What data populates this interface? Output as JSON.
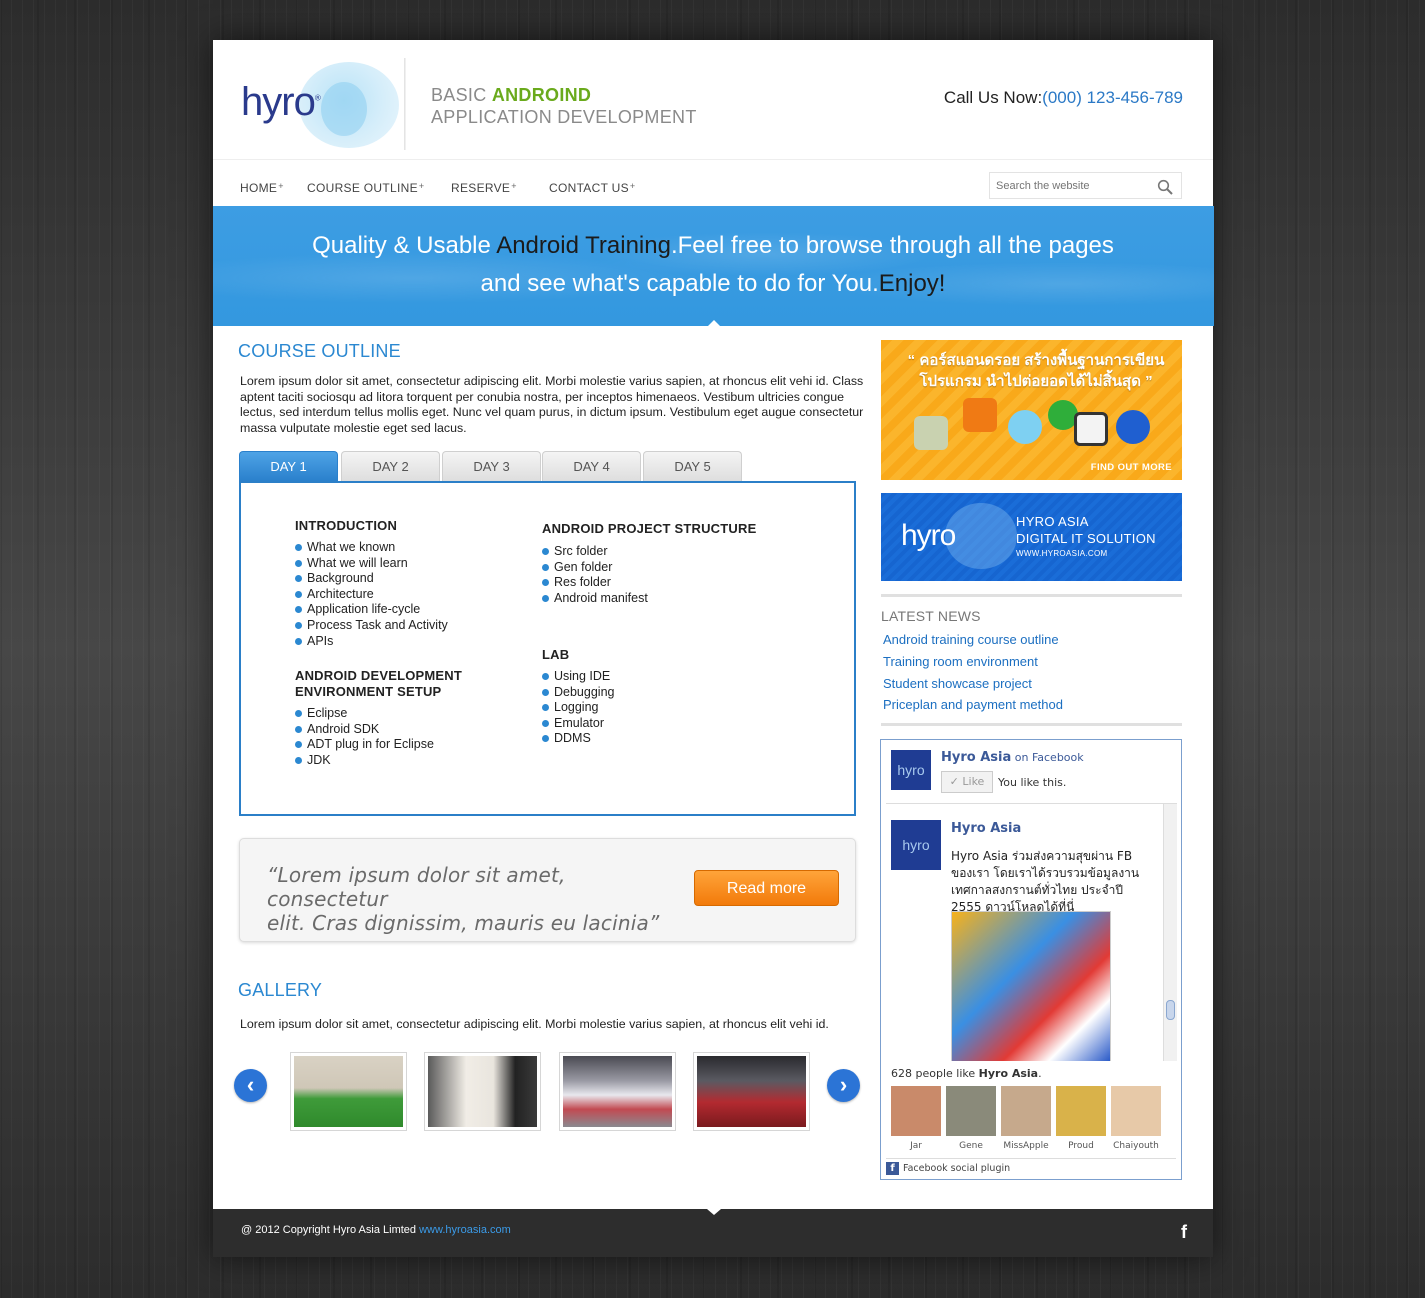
{
  "header": {
    "logo_text": "hyro",
    "title_prefix": "BASIC ",
    "title_accent": "ANDROIND",
    "title_line2": "APPLICATION DEVELOPMENT",
    "call_label": "Call Us Now:",
    "call_phone": "(000) 123-456-789"
  },
  "nav": {
    "items": [
      {
        "label": "HOME"
      },
      {
        "label": "COURSE OUTLINE"
      },
      {
        "label": "RESERVE"
      },
      {
        "label": "CONTACT US"
      }
    ],
    "plus": "+",
    "search_placeholder": "Search the website"
  },
  "hero": {
    "l1_a": "Quality & Usable ",
    "l1_b": "Android Training",
    "l1_c": ".Feel free to browse through all the pages",
    "l2_a": "and see what's capable to do for You.",
    "l2_b": "Enjoy",
    "l2_c": "!"
  },
  "course": {
    "heading": "COURSE OUTLINE",
    "intro": "Lorem ipsum dolor sit amet, consectetur adipiscing elit. Morbi molestie varius sapien, at rhoncus elit vehi id. Class aptent taciti sociosqu ad litora torquent per conubia nostra, per inceptos himenaeos. Vestibum ultricies congue lectus, sed interdum tellus mollis eget. Nunc vel quam purus, in dictum ipsum. Vestibulum eget augue consectetur massa vulputate molestie eget sed lacus.",
    "tabs": [
      {
        "label": "DAY 1",
        "active": true
      },
      {
        "label": "DAY 2",
        "active": false
      },
      {
        "label": "DAY 3",
        "active": false
      },
      {
        "label": "DAY 4",
        "active": false
      },
      {
        "label": "DAY 5",
        "active": false
      }
    ],
    "sections": {
      "intro_title": "INTRODUCTION",
      "intro_items": [
        "What we known",
        "What we will learn",
        "Background",
        "Architecture",
        "Application life-cycle",
        "Process Task and Activity",
        "APIs"
      ],
      "setup_title_1": "ANDROID DEVELOPMENT",
      "setup_title_2": "ENVIRONMENT SETUP",
      "setup_items": [
        "Eclipse",
        "Android SDK",
        "ADT plug in for Eclipse",
        "JDK"
      ],
      "structure_title": "ANDROID PROJECT STRUCTURE",
      "structure_items": [
        "Src folder",
        "Gen folder",
        "Res folder",
        "Android manifest"
      ],
      "lab_title": "LAB",
      "lab_items": [
        "Using IDE",
        "Debugging",
        "Logging",
        "Emulator",
        "DDMS"
      ]
    }
  },
  "quote": {
    "line1": "“Lorem ipsum dolor sit amet, consectetur",
    "line2": "elit. Cras dignissim, mauris eu lacinia”",
    "button": "Read more"
  },
  "gallery": {
    "heading": "GALLERY",
    "text": "Lorem ipsum dolor sit amet, consectetur adipiscing elit. Morbi molestie varius sapien, at rhoncus elit vehi id.",
    "prev": "‹",
    "next": "›"
  },
  "sidebar": {
    "banner1_line1": "“ คอร์สแอนดรอย สร้างพื้นฐานการเขียน",
    "banner1_line2": "โปรแกรม นำไปต่อยอดได้ไม่สิ้นสุด ”",
    "banner1_cta": "FIND OUT MORE",
    "banner2_logo": "hyro",
    "banner2_line1": "HYRO ASIA",
    "banner2_line2": "DIGITAL IT SOLUTION",
    "banner2_url": "WWW.HYROASIA.COM",
    "news_title": "LATEST NEWS",
    "news": [
      {
        "label": "Android training course outline"
      },
      {
        "label": "Training room environment"
      },
      {
        "label": "Student showcase project"
      },
      {
        "label": "Priceplan and payment method"
      }
    ]
  },
  "facebook": {
    "page_name": "Hyro Asia",
    "on_facebook": " on Facebook",
    "like_button": "✓ Like",
    "you_like": "You like this.",
    "post_author": "Hyro Asia",
    "post_text": "Hyro Asia ร่วมส่งความสุขผ่าน FB ของเรา โดยเราได้รวบรวมข้อมูลงานเทศกาลสงกรานต์ทั่วไทย ประจำปี 2555 ดาวน์โหลดได้ที่นี่",
    "likes_count": "628 people like ",
    "likes_page": "Hyro Asia",
    "likes_dot": ".",
    "fans": [
      {
        "name": "Jar",
        "color": "#c98a6a"
      },
      {
        "name": "Gene",
        "color": "#8a8a7a"
      },
      {
        "name": "MissApple",
        "color": "#c6a98c"
      },
      {
        "name": "Proud",
        "color": "#d9b24a"
      },
      {
        "name": "Chaiyouth",
        "color": "#e7c9a8"
      }
    ],
    "footer": "Facebook social plugin",
    "logo_small": "hyro"
  },
  "footer": {
    "copyright": "@ 2012 Copyright Hyro Asia Limted ",
    "link": "www.hyroasia.com",
    "fb": "f"
  },
  "colors": {
    "accent_blue": "#2b88d1",
    "brand_green": "#6aaa1c",
    "button_orange": "#f27a0a"
  }
}
